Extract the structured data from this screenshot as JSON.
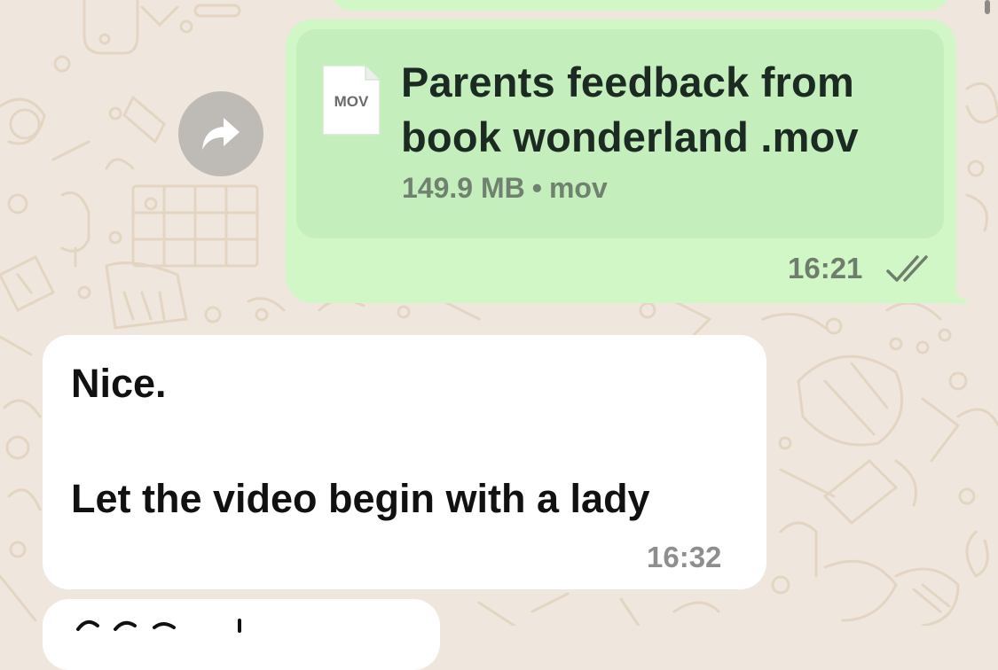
{
  "chat": {
    "outgoing_file": {
      "file_type": "MOV",
      "title": "Parents feedback from book wonderland .mov",
      "size": "149.9 MB",
      "separator": "•",
      "extension": "mov",
      "time": "16:21",
      "status_icon": "double-check-icon"
    },
    "forward_button": {
      "icon": "forward-arrow-icon"
    },
    "incoming_message": {
      "text": "Nice.\n\nLet the video begin with a lady",
      "time": "16:32"
    },
    "colors": {
      "outgoing_bubble": "#d2f7c7",
      "file_card": "#c4eebb",
      "incoming_bubble": "#ffffff",
      "wallpaper": "#efe7dd"
    }
  }
}
